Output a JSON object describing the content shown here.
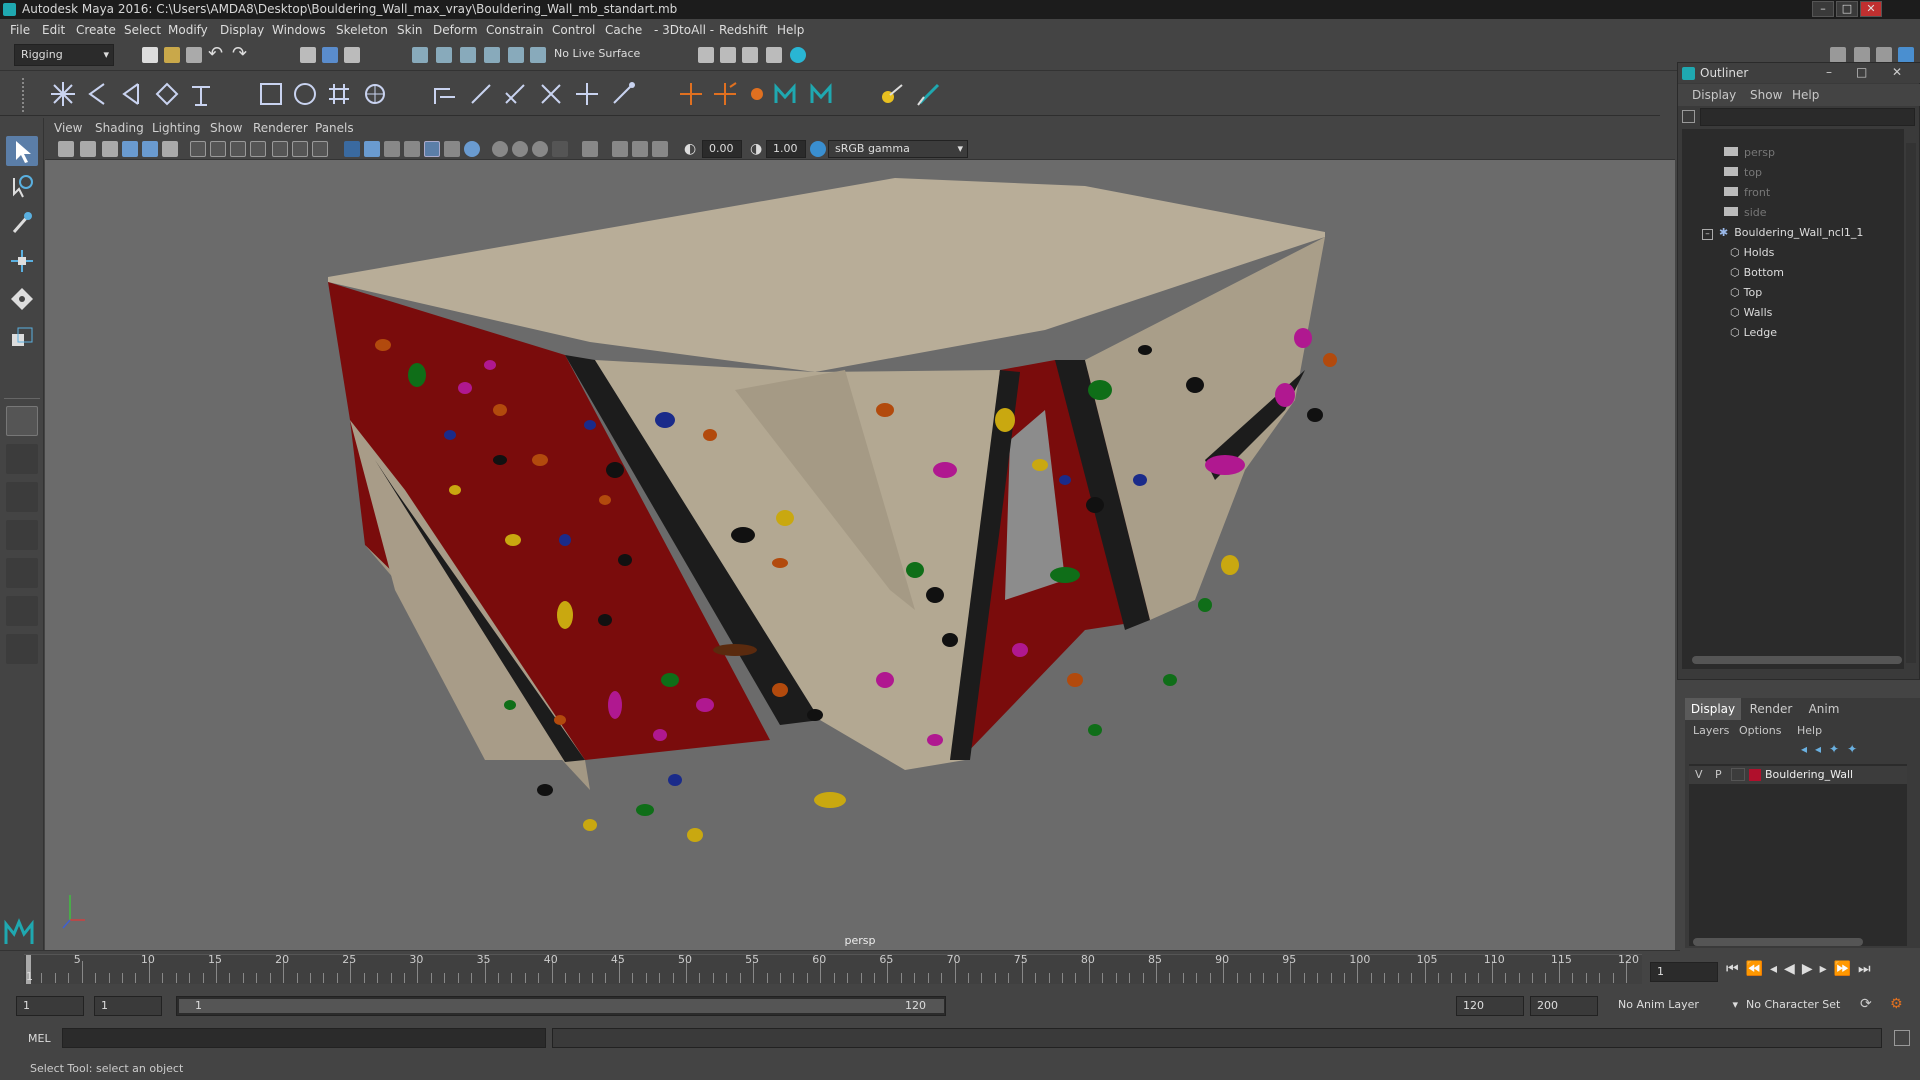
{
  "titlebar": {
    "title": "Autodesk Maya 2016: C:\\Users\\AMDA8\\Desktop\\Bouldering_Wall_max_vray\\Bouldering_Wall_mb_standart.mb"
  },
  "menubar": {
    "items": [
      "File",
      "Edit",
      "Create",
      "Select",
      "Modify",
      "Display",
      "Windows",
      "Skeleton",
      "Skin",
      "Deform",
      "Constrain",
      "Control",
      "Cache",
      "- 3DtoAll -",
      "Redshift",
      "Help"
    ]
  },
  "status_line": {
    "menu_set": "Rigging",
    "live_surface": "No Live Surface"
  },
  "panel_menu": [
    "View",
    "Shading",
    "Lighting",
    "Show",
    "Renderer",
    "Panels"
  ],
  "panel_toolbar": {
    "near_value": "0.00",
    "far_value": "1.00",
    "color_space": "sRGB gamma"
  },
  "viewport": {
    "camera_label": "persp"
  },
  "outliner": {
    "title": "Outliner",
    "menu": [
      "Display",
      "Show",
      "Help"
    ],
    "cameras": [
      "persp",
      "top",
      "front",
      "side"
    ],
    "group": "Bouldering_Wall_ncl1_1",
    "children": [
      "Holds",
      "Bottom",
      "Top",
      "Walls",
      "Ledge"
    ]
  },
  "layer_editor": {
    "tabs": [
      "Display",
      "Render",
      "Anim"
    ],
    "menu": [
      "Layers",
      "Options",
      "Help"
    ],
    "layer": {
      "v": "V",
      "p": "P",
      "name": "Bouldering_Wall",
      "color": "#b0102c"
    }
  },
  "timeline": {
    "ticks": [
      "5",
      "10",
      "15",
      "20",
      "25",
      "30",
      "35",
      "40",
      "45",
      "50",
      "55",
      "60",
      "65",
      "70",
      "75",
      "80",
      "85",
      "90",
      "95",
      "100",
      "105",
      "110",
      "115",
      "120"
    ],
    "start_label": "1",
    "current_frame": "1"
  },
  "range": {
    "start": "1",
    "playback_start": "1",
    "slider_start": "1",
    "slider_end": "120",
    "playback_end": "120",
    "end": "200",
    "anim_layer": "No Anim Layer",
    "character_set": "No Character Set"
  },
  "command_line": {
    "label": "MEL"
  },
  "help_line": {
    "text": "Select Tool: select an object"
  }
}
